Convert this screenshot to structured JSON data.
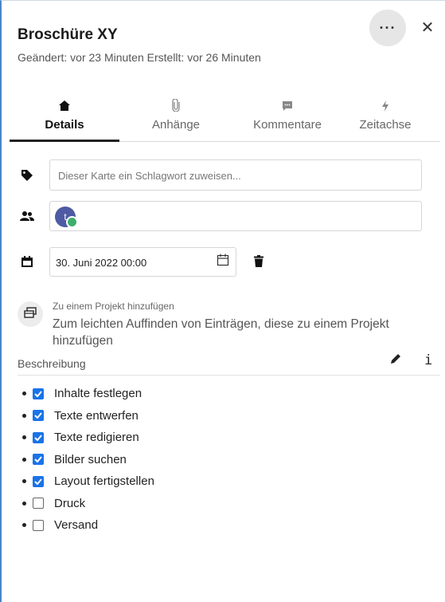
{
  "card": {
    "title": "Broschüre XY",
    "meta": "Geändert: vor 23 Minuten Erstellt: vor 26 Minuten",
    "more_label": "···",
    "close_label": "✕"
  },
  "tabs": [
    {
      "label": "Details",
      "icon": "home-icon"
    },
    {
      "label": "Anhänge",
      "icon": "paperclip-icon"
    },
    {
      "label": "Kommentare",
      "icon": "comment-icon"
    },
    {
      "label": "Zeitachse",
      "icon": "lightning-icon"
    }
  ],
  "tag": {
    "placeholder": "Dieser Karte ein Schlagwort zuweisen..."
  },
  "assignee": {
    "avatar_initial": "t"
  },
  "due_date": {
    "value": "30. Juni 2022 00:00"
  },
  "project": {
    "small_label": "Zu einem Projekt hinzufügen",
    "hint": "Zum leichten Auffinden von Einträgen, diese zu einem Projekt hinzufügen"
  },
  "description": {
    "heading": "Beschreibung",
    "info_label": "i",
    "items": [
      {
        "label": "Inhalte festlegen",
        "checked": true
      },
      {
        "label": "Texte entwerfen",
        "checked": true
      },
      {
        "label": "Texte redigieren",
        "checked": true
      },
      {
        "label": "Bilder suchen",
        "checked": true
      },
      {
        "label": "Layout fertigstellen",
        "checked": true
      },
      {
        "label": "Druck",
        "checked": false
      },
      {
        "label": "Versand",
        "checked": false
      }
    ]
  },
  "colors": {
    "accent": "#1a73e8",
    "avatar": "#4e5aa3",
    "status_online": "#3fae6c"
  }
}
